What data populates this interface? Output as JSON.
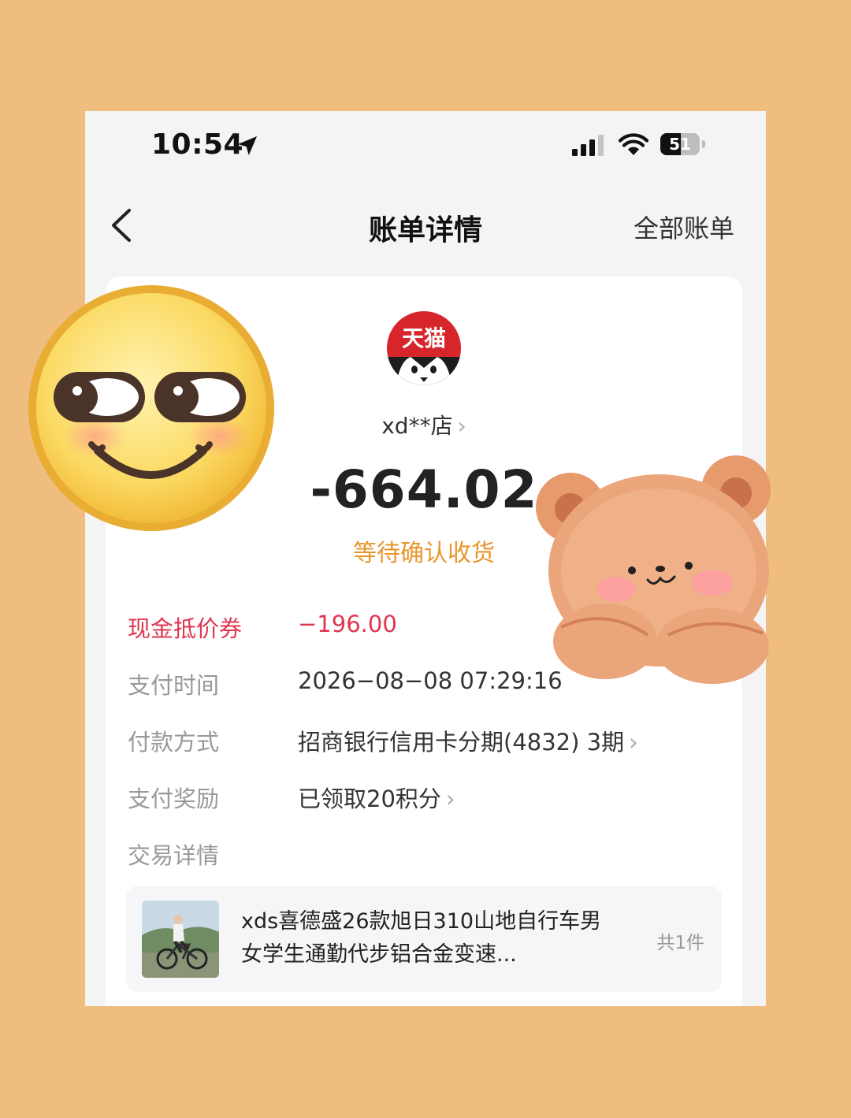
{
  "status_bar": {
    "time": "10:54",
    "battery": "51",
    "battery_level": 0.51,
    "icons": [
      "location-arrow-icon",
      "signal-icon",
      "wifi-icon",
      "battery-icon"
    ]
  },
  "nav": {
    "title": "账单详情",
    "right_link": "全部账单",
    "back_icon": "chevron-left-icon"
  },
  "merchant": {
    "logo_text": "天猫",
    "name": "xd**店",
    "amount": "-664.02",
    "status": "等待确认收货"
  },
  "details": [
    {
      "label": "现金抵价券",
      "value": "−196.00"
    },
    {
      "label": "支付时间",
      "value": "2026−08−08 07:29:16"
    },
    {
      "label": "付款方式",
      "value": "招商银行信用卡分期(4832) 3期"
    },
    {
      "label": "支付奖励",
      "value": "已领取20积分"
    },
    {
      "label": "交易详情",
      "value": ""
    }
  ],
  "product": {
    "title": "xds喜德盛26款旭日310山地自行车男女学生通勤代步铝合金变速...",
    "count": "共1件"
  },
  "colors": {
    "background": "#EFBD7E",
    "accent_red": "#E0364F",
    "status_orange": "#E8952A",
    "tmall_red": "#D7262B"
  }
}
